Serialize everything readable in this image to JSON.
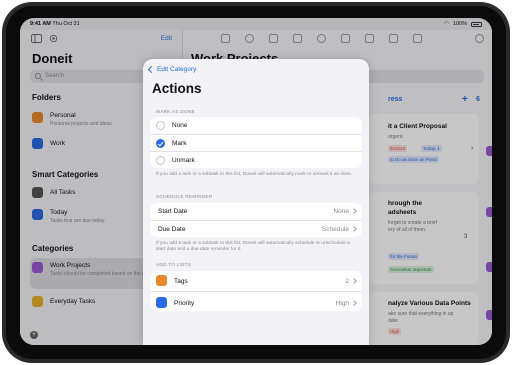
{
  "status_bar": {
    "time": "9:41 AM",
    "date": "Thu Oct 31",
    "battery": "100%"
  },
  "sidebar": {
    "edit_label": "Edit",
    "title": "Doneit",
    "search_placeholder": "Search",
    "folders_heading": "Folders",
    "folders": [
      {
        "label": "Personal",
        "subtitle": "Personal projects and ideas",
        "color": "#e8892b"
      },
      {
        "label": "Work",
        "subtitle": "",
        "color": "#2b6ae0"
      }
    ],
    "smart_heading": "Smart Categories",
    "smart": [
      {
        "label": "All Tasks",
        "subtitle": "",
        "color": "#555555"
      },
      {
        "label": "Today",
        "subtitle": "Tasks that are due today",
        "color": "#2b6ae0"
      }
    ],
    "categories_heading": "Categories",
    "categories": [
      {
        "label": "Work Projects",
        "subtitle": "Tasks should be completed based on the priority",
        "color": "#9b59d0"
      },
      {
        "label": "Everyday Tasks",
        "subtitle": "",
        "color": "#e8b02b"
      }
    ]
  },
  "main": {
    "title": "Work Projects",
    "column_header": "ress",
    "column_count": "6",
    "cards": [
      {
        "title": "it a Client Proposal",
        "line": "urgent.",
        "tag1": "9/15/24",
        "tag2": "Today, 1",
        "tag3": "to Do as Soon as Possi"
      },
      {
        "title": "hrough the",
        "title2": "adsheets",
        "line": "forget to create a brief",
        "line2": "ery of all of them.",
        "tag1": "for the Future",
        "tag2": "Somewhat Important",
        "count": "3"
      },
      {
        "title": "nalyze Various Data Points",
        "line": "ake sure that everything is up",
        "line2": "date.",
        "tag1": "High"
      }
    ],
    "colors": {
      "accent": "#2b6ae0",
      "done": "#34a853",
      "high": "#e04b3a"
    }
  },
  "modal": {
    "back_label": "Edit Category",
    "title": "Actions",
    "mark_as_done": {
      "label": "Mark as Done",
      "options": [
        "None",
        "Mark",
        "Unmark"
      ],
      "selected": "Mark",
      "note": "If you add a task or a subtask to this list, Doneit will automatically mark or unmark it as done."
    },
    "schedule_reminder": {
      "label": "Schedule Reminder",
      "start_date": {
        "label": "Start Date",
        "value": "None"
      },
      "due_date": {
        "label": "Due Date",
        "value": "Schedule"
      },
      "note": "If you add a task or a subtask to this list, Doneit will automatically schedule or unschedule a start date and a due date reminder for it."
    },
    "add_to_lists": {
      "label": "Add to Lists",
      "tags": {
        "label": "Tags",
        "value": "2",
        "icon": "tag-icon"
      },
      "priority": {
        "label": "Priority",
        "value": "High",
        "icon": "priority-icon"
      }
    }
  }
}
